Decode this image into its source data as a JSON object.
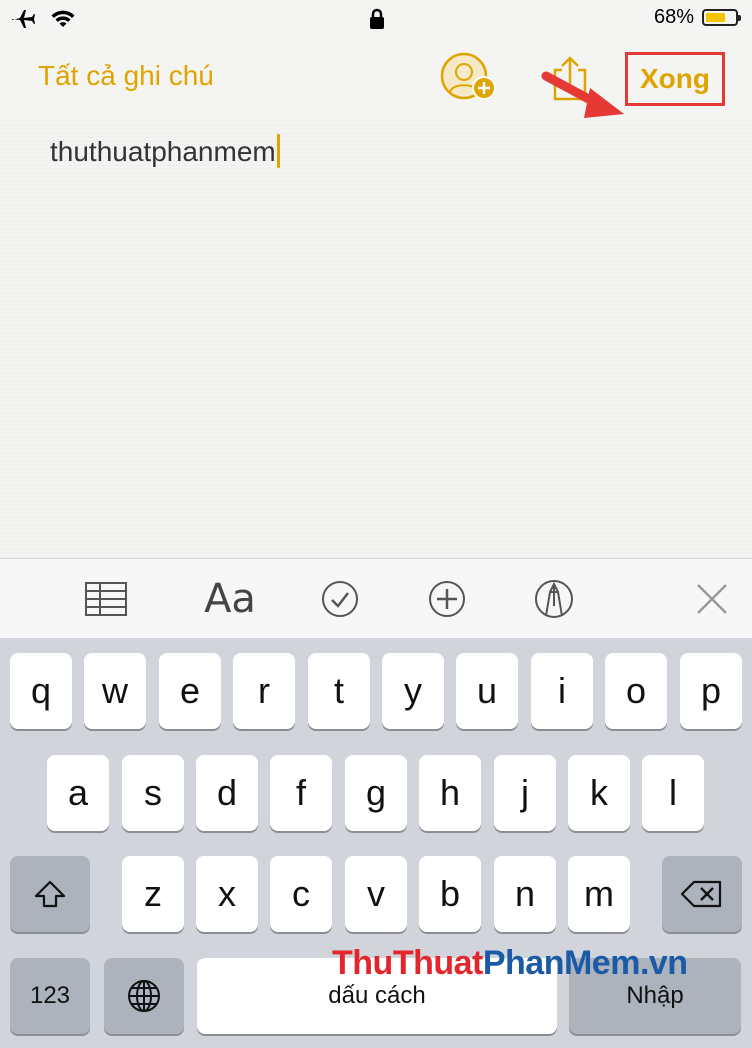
{
  "status_bar": {
    "battery_percent": "68%",
    "battery_level": 0.68,
    "icons": [
      "airplane-icon",
      "wifi-icon",
      "lock-icon",
      "battery-icon"
    ]
  },
  "navbar": {
    "back_label": "Tất cả ghi chú",
    "done_label": "Xong",
    "accent_color": "#e0a400",
    "highlight_color": "#e53935"
  },
  "note": {
    "text": "thuthuatphanmem"
  },
  "toolbar": {
    "items": [
      "table-icon",
      "text-format-icon",
      "checklist-icon",
      "add-icon",
      "markup-icon",
      "close-icon"
    ],
    "format_label": "Aa"
  },
  "keyboard": {
    "row1": [
      "q",
      "w",
      "e",
      "r",
      "t",
      "y",
      "u",
      "i",
      "o",
      "p"
    ],
    "row2": [
      "a",
      "s",
      "d",
      "f",
      "g",
      "h",
      "j",
      "k",
      "l"
    ],
    "row3": [
      "z",
      "x",
      "c",
      "v",
      "b",
      "n",
      "m"
    ],
    "numbers_label": "123",
    "space_label": "dấu cách",
    "return_label": "Nhập"
  },
  "watermark": {
    "part1": "Thu",
    "part2": "Thuat",
    "part3": "PhanMem",
    "part4": ".vn"
  }
}
